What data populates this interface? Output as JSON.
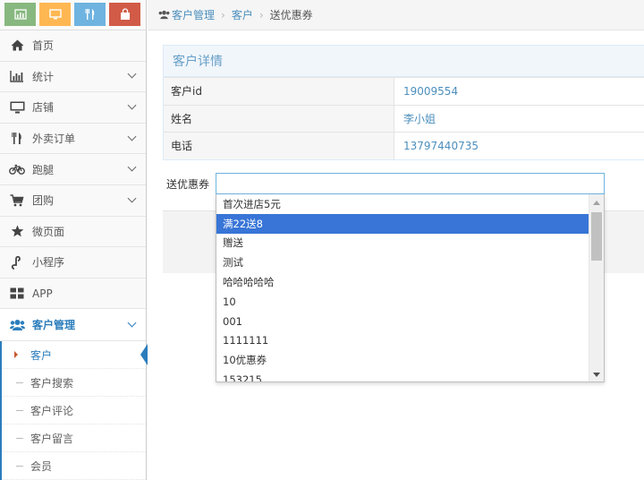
{
  "shortcuts": [
    {
      "name": "stats-shortcut",
      "icon": "bar-chart-icon",
      "color": "#87b87f"
    },
    {
      "name": "monitor-shortcut",
      "icon": "monitor-icon",
      "color": "#ffb752"
    },
    {
      "name": "food-shortcut",
      "icon": "cutlery-icon",
      "color": "#6fb3e0"
    },
    {
      "name": "shop-shortcut",
      "icon": "shopping-bag-icon",
      "color": "#d15b47"
    }
  ],
  "sidebar": {
    "items": [
      {
        "label": "首页",
        "icon": "home-icon"
      },
      {
        "label": "统计",
        "icon": "bar-chart-icon"
      },
      {
        "label": "店铺",
        "icon": "desktop-icon"
      },
      {
        "label": "外卖订单",
        "icon": "cutlery-icon"
      },
      {
        "label": "跑腿",
        "icon": "bicycle-icon"
      },
      {
        "label": "团购",
        "icon": "cart-icon"
      },
      {
        "label": "微页面",
        "icon": "star-icon"
      },
      {
        "label": "小程序",
        "icon": "link-icon"
      },
      {
        "label": "APP",
        "icon": "grid-icon"
      }
    ],
    "open_group": {
      "label": "客户管理",
      "icon": "users-icon"
    },
    "sub_items": [
      {
        "label": "客户",
        "active": true
      },
      {
        "label": "客户搜索"
      },
      {
        "label": "客户评论"
      },
      {
        "label": "客户留言"
      },
      {
        "label": "会员"
      }
    ]
  },
  "breadcrumb": {
    "root": "客户管理",
    "mid": "客户",
    "current": "送优惠券"
  },
  "detail": {
    "title": "客户详情",
    "rows": [
      {
        "key": "客户id",
        "value": "19009554"
      },
      {
        "key": "姓名",
        "value": "李小姐"
      },
      {
        "key": "电话",
        "value": "13797440735"
      }
    ]
  },
  "coupon": {
    "label": "送优惠券",
    "value": "",
    "options": [
      "首次进店5元",
      "满22送8",
      "赠送",
      "测试",
      "哈哈哈哈哈",
      "10",
      "001",
      "1111111",
      "10优惠券",
      "153215"
    ],
    "selected_index": 1
  }
}
